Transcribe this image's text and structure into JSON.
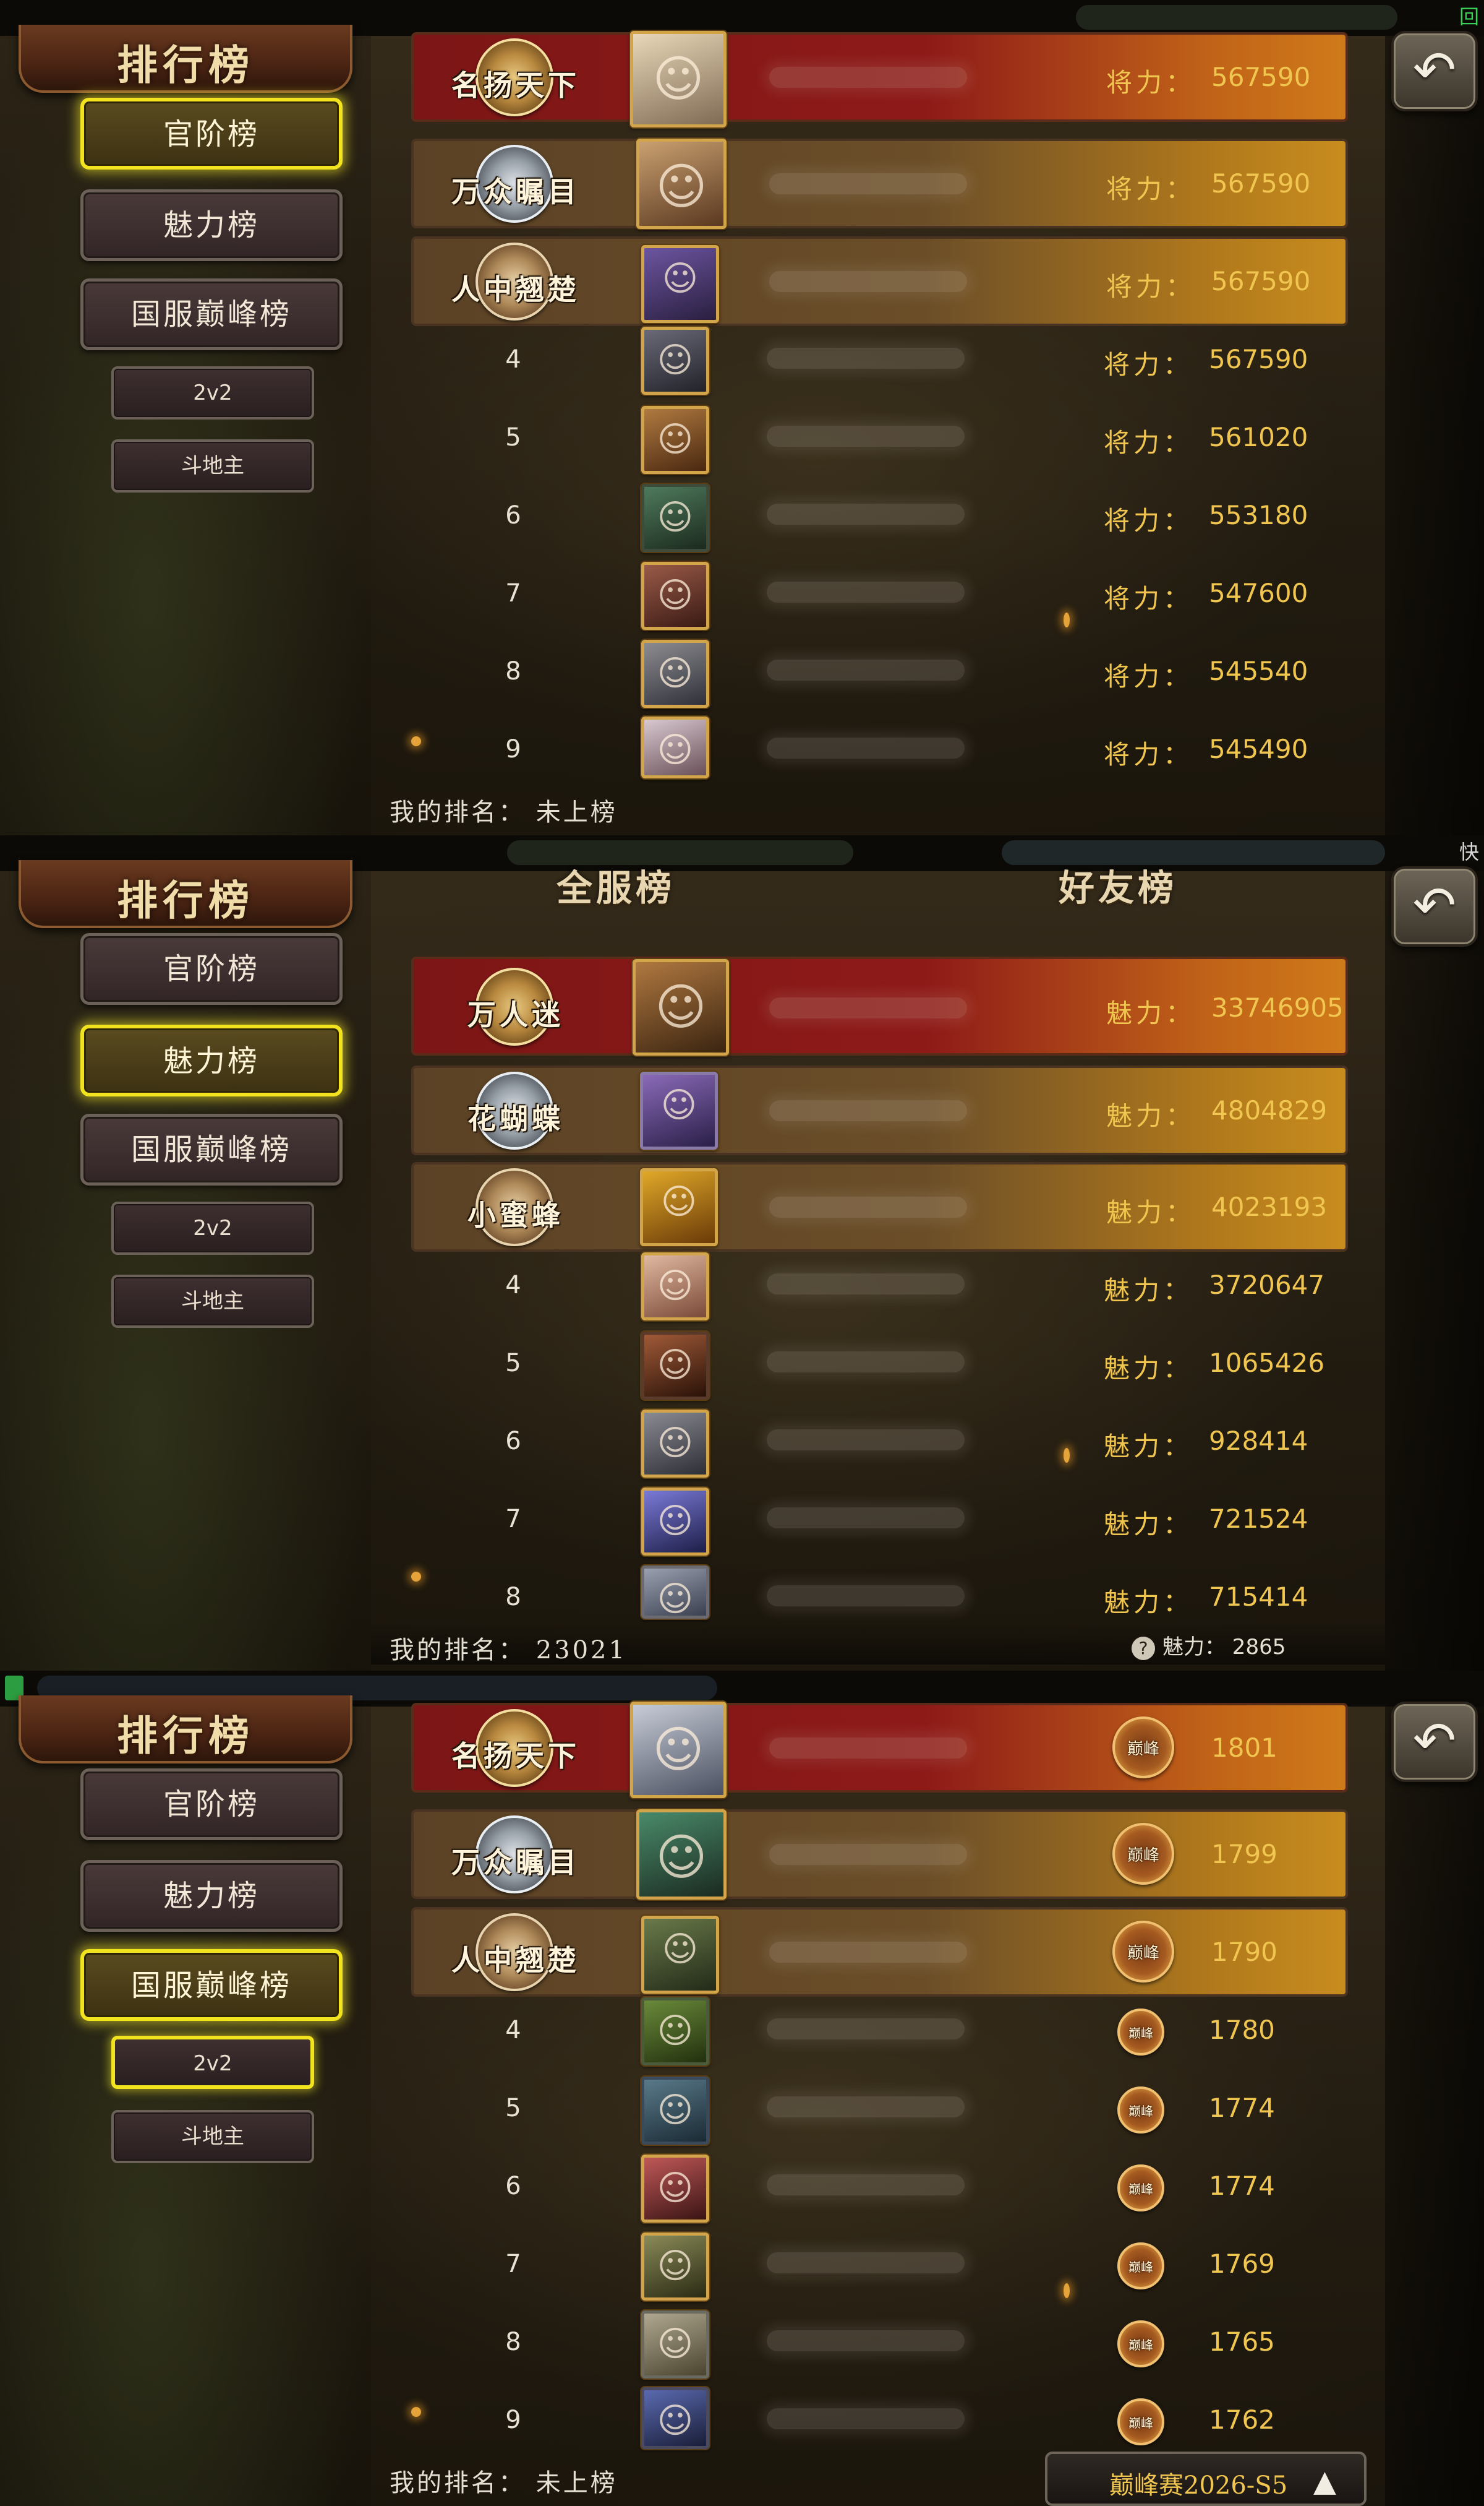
{
  "screens": [
    {
      "title": "排行榜",
      "status_corner": "回",
      "tabs": [
        "官阶榜",
        "魅力榜",
        "国服巅峰榜"
      ],
      "subtabs": [
        "2v2",
        "斗地主"
      ],
      "active_tab": "官阶榜",
      "stat_label": "将力：",
      "top_medals": [
        "名扬天下",
        "万众瞩目",
        "人中翘楚"
      ],
      "rows": [
        {
          "rank": "1",
          "value": "567590"
        },
        {
          "rank": "2",
          "value": "567590"
        },
        {
          "rank": "3",
          "value": "567590"
        },
        {
          "rank": "4",
          "value": "567590"
        },
        {
          "rank": "5",
          "value": "561020"
        },
        {
          "rank": "6",
          "value": "553180"
        },
        {
          "rank": "7",
          "value": "547600"
        },
        {
          "rank": "8",
          "value": "545540"
        },
        {
          "rank": "9",
          "value": "545490"
        }
      ],
      "my_rank": "我的排名： 未上榜"
    },
    {
      "title": "排行榜",
      "status_corner": "快",
      "tabs": [
        "官阶榜",
        "魅力榜",
        "国服巅峰榜"
      ],
      "subtabs": [
        "2v2",
        "斗地主"
      ],
      "active_tab": "魅力榜",
      "column_tabs": [
        "全服榜",
        "好友榜"
      ],
      "stat_label": "魅力：",
      "top_medals": [
        "万人迷",
        "花蝴蝶",
        "小蜜蜂"
      ],
      "rows": [
        {
          "rank": "1",
          "value": "33746905"
        },
        {
          "rank": "2",
          "value": "4804829"
        },
        {
          "rank": "3",
          "value": "4023193"
        },
        {
          "rank": "4",
          "value": "3720647"
        },
        {
          "rank": "5",
          "value": "1065426"
        },
        {
          "rank": "6",
          "value": "928414"
        },
        {
          "rank": "7",
          "value": "721524"
        },
        {
          "rank": "8",
          "value": "715414"
        }
      ],
      "my_rank": "我的排名： 23021",
      "my_charm": "魅力： 2865"
    },
    {
      "title": "排行榜",
      "tabs": [
        "官阶榜",
        "魅力榜",
        "国服巅峰榜"
      ],
      "subtabs": [
        "2v2",
        "斗地主"
      ],
      "active_tab": "国服巅峰榜",
      "badge_text": "巅峰",
      "top_medals": [
        "名扬天下",
        "万众瞩目",
        "人中翘楚"
      ],
      "rows": [
        {
          "rank": "1",
          "value": "1801"
        },
        {
          "rank": "2",
          "value": "1799"
        },
        {
          "rank": "3",
          "value": "1790"
        },
        {
          "rank": "4",
          "value": "1780"
        },
        {
          "rank": "5",
          "value": "1774"
        },
        {
          "rank": "6",
          "value": "1774"
        },
        {
          "rank": "7",
          "value": "1769"
        },
        {
          "rank": "8",
          "value": "1765"
        },
        {
          "rank": "9",
          "value": "1762"
        }
      ],
      "my_rank": "我的排名： 未上榜",
      "season_label": "巅峰赛2026-S5"
    }
  ],
  "icons": {
    "back": "back-arrow-icon",
    "help": "question-icon",
    "expand": "triangle-up-icon"
  },
  "colors": {
    "gold_text": "#f0c650",
    "active_tab_border": "#f2e31f",
    "rank1_row": "#8e1a18",
    "rank23_row": "#6b4e28"
  }
}
